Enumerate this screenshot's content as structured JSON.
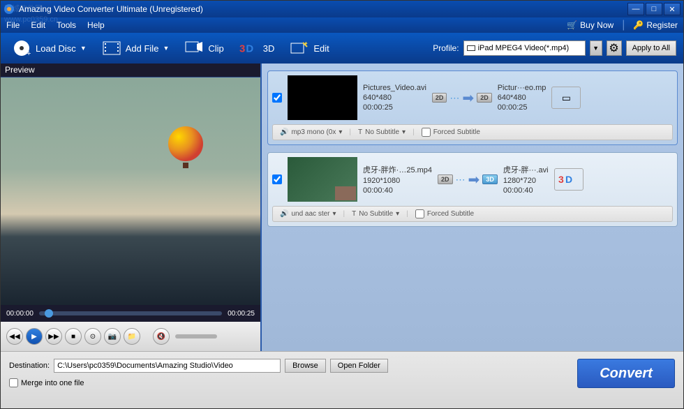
{
  "titlebar": {
    "text": "Amazing Video Converter Ultimate (Unregistered)"
  },
  "menu": {
    "file": "File",
    "edit": "Edit",
    "tools": "Tools",
    "help": "Help",
    "buy": "Buy Now",
    "register": "Register"
  },
  "toolbar": {
    "loadDisc": "Load Disc",
    "addFile": "Add File",
    "clip": "Clip",
    "3d": "3D",
    "edit": "Edit",
    "profileLabel": "Profile:",
    "profileValue": "iPad MPEG4 Video(*.mp4)",
    "applyAll": "Apply to All"
  },
  "preview": {
    "title": "Preview",
    "timeStart": "00:00:00",
    "timeEnd": "00:00:25"
  },
  "items": [
    {
      "src": {
        "name": "Pictures_Video.avi",
        "res": "640*480",
        "dur": "00:00:25"
      },
      "out": {
        "name": "Pictur···eo.mp",
        "res": "640*480",
        "dur": "00:00:25"
      },
      "srcBadge": "2D",
      "outBadge": "2D",
      "audio": "mp3 mono (0x",
      "subtitle": "No Subtitle",
      "forced": "Forced Subtitle"
    },
    {
      "src": {
        "name": "虎牙-胖炸·…25.mp4",
        "res": "1920*1080",
        "dur": "00:00:40"
      },
      "out": {
        "name": "虎牙-胖···.avi",
        "res": "1280*720",
        "dur": "00:00:40"
      },
      "srcBadge": "2D",
      "outBadge": "3D",
      "audio": "und aac ster",
      "subtitle": "No Subtitle",
      "forced": "Forced Subtitle"
    }
  ],
  "bottom": {
    "destLabel": "Destination:",
    "destValue": "C:\\Users\\pc0359\\Documents\\Amazing Studio\\Video",
    "browse": "Browse",
    "openFolder": "Open Folder",
    "merge": "Merge into one file",
    "convert": "Convert"
  },
  "watermark": {
    "line1": "同城软件园",
    "line2": "www.pc0359.cn"
  }
}
